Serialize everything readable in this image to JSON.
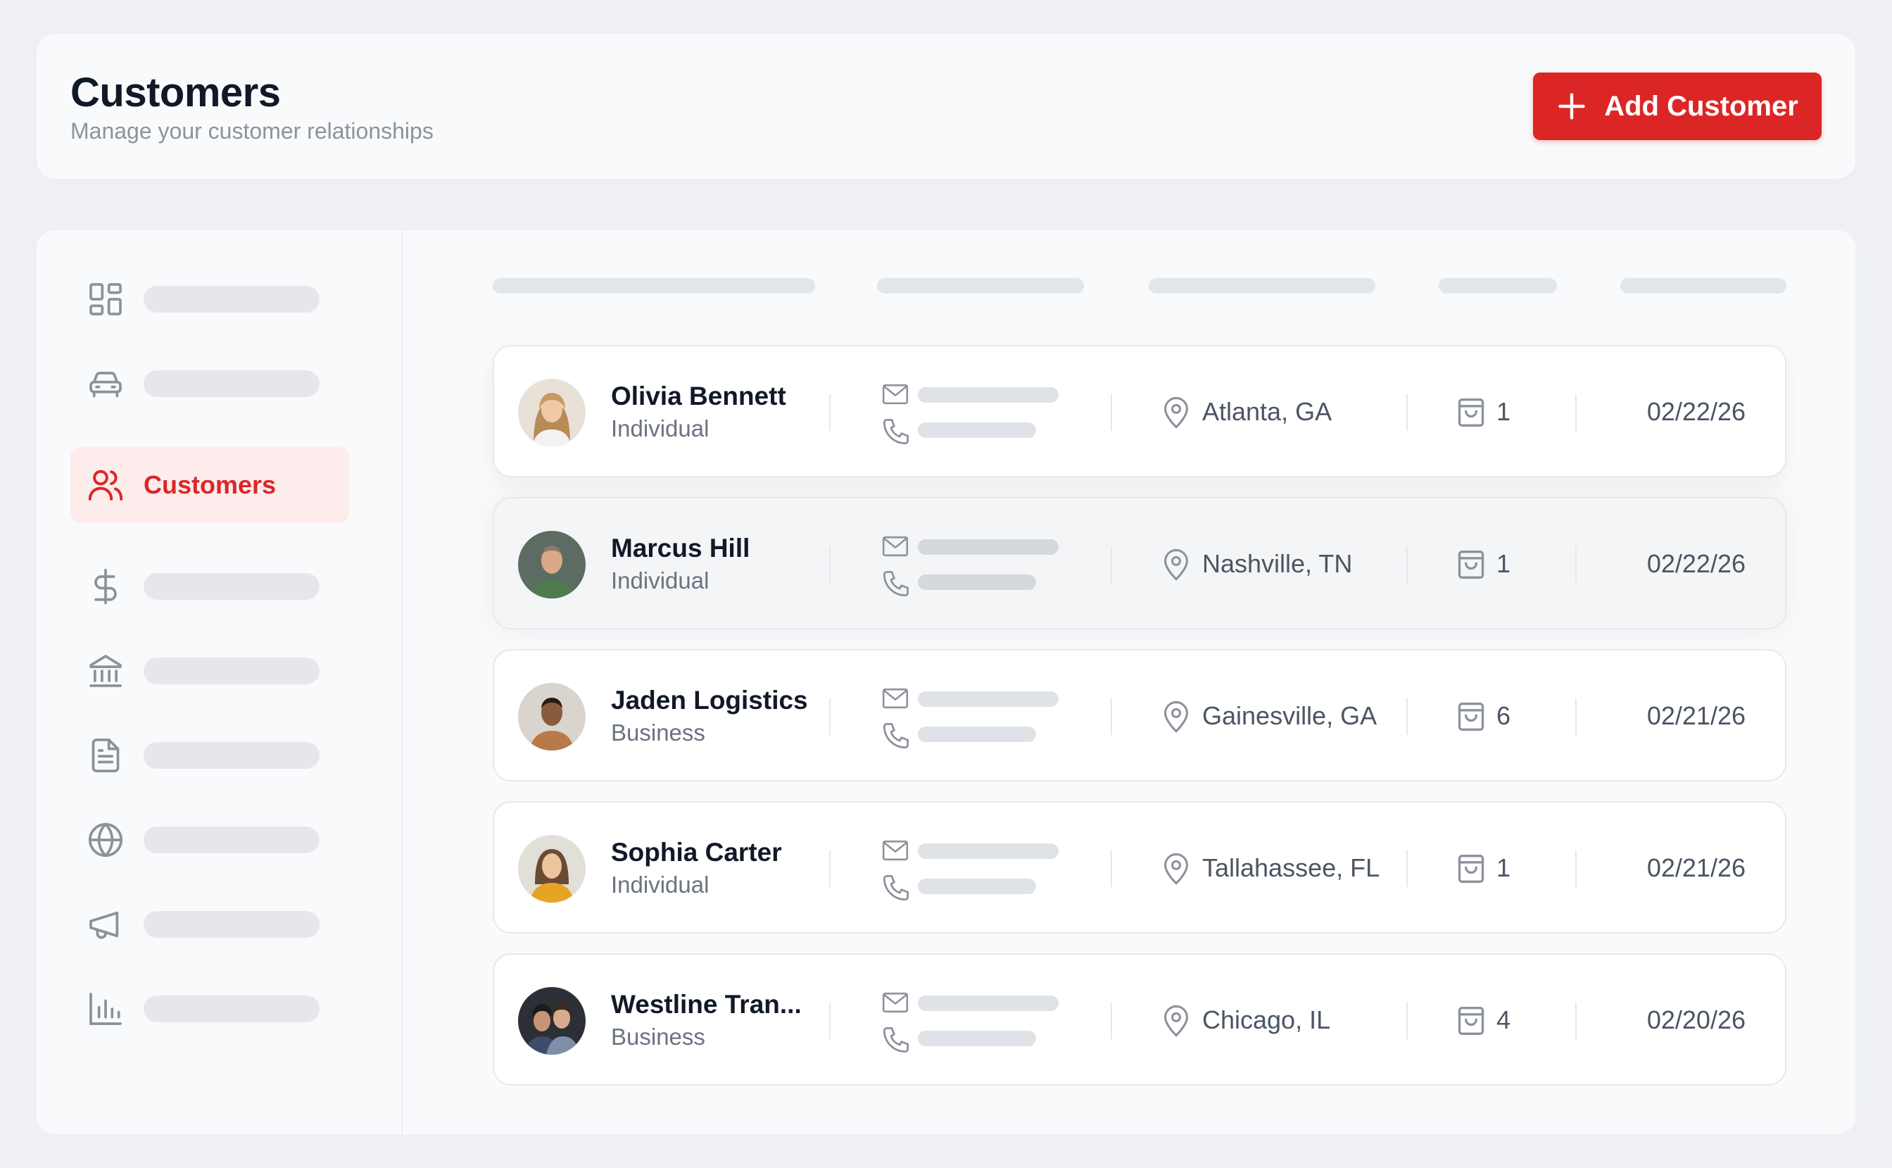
{
  "header": {
    "title": "Customers",
    "subtitle": "Manage your customer relationships",
    "add_button_label": "Add Customer"
  },
  "sidebar": {
    "items": [
      {
        "icon": "dashboard-icon",
        "label": ""
      },
      {
        "icon": "car-icon",
        "label": ""
      },
      {
        "icon": "users-icon",
        "label": "Customers",
        "active": true
      },
      {
        "icon": "dollar-icon",
        "label": ""
      },
      {
        "icon": "bank-icon",
        "label": ""
      },
      {
        "icon": "document-icon",
        "label": ""
      },
      {
        "icon": "globe-icon",
        "label": ""
      },
      {
        "icon": "megaphone-icon",
        "label": ""
      },
      {
        "icon": "bar-chart-icon",
        "label": ""
      }
    ]
  },
  "customers": [
    {
      "name": "Olivia Bennett",
      "type": "Individual",
      "location": "Atlanta, GA",
      "orders": "1",
      "date": "02/22/26"
    },
    {
      "name": "Marcus Hill",
      "type": "Individual",
      "location": "Nashville, TN",
      "orders": "1",
      "date": "02/22/26"
    },
    {
      "name": "Jaden Logistics",
      "type": "Business",
      "location": "Gainesville, GA",
      "orders": "6",
      "date": "02/21/26"
    },
    {
      "name": "Sophia Carter",
      "type": "Individual",
      "location": "Tallahassee, FL",
      "orders": "1",
      "date": "02/21/26"
    },
    {
      "name": "Westline Tran...",
      "type": "Business",
      "location": "Chicago, IL",
      "orders": "4",
      "date": "02/20/26"
    }
  ],
  "colors": {
    "accent": "#dc2626",
    "active_bg": "#fdecec",
    "text_primary": "#111827",
    "text_secondary": "#6b7280",
    "placeholder": "#e2e5e9"
  }
}
